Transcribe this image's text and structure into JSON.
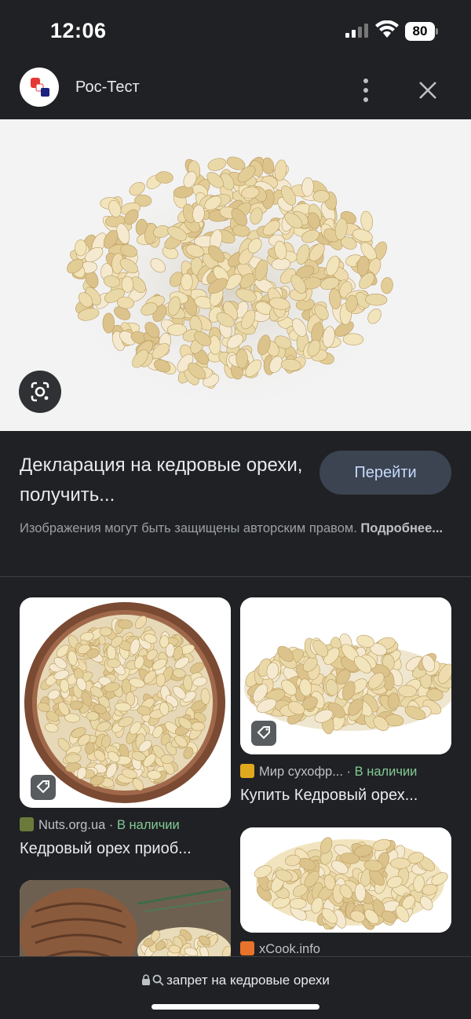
{
  "status_bar": {
    "time": "12:06",
    "battery": "80"
  },
  "header": {
    "site_title": "Рос-Тест"
  },
  "main": {
    "headline": "Декларация на кедровые орехи, получить...",
    "go_label": "Перейти",
    "copyright_text": "Изображения могут быть защищены авторским правом.",
    "copyright_link": "Подробнее..."
  },
  "results": [
    {
      "source": "Nuts.org.ua",
      "availability": "В наличии",
      "title": "Кедровый орех приоб..."
    },
    {
      "source": "Мир сухофр...",
      "availability": "В наличии",
      "title": "Купить Кедровый орех..."
    },
    {
      "source": "xCook.info"
    }
  ],
  "bottom": {
    "query": "запрет на кедровые орехи"
  },
  "colors": {
    "background": "#202124",
    "button_bg": "#3c4452",
    "availability_green": "#81c995",
    "muted_text": "#9aa0a6"
  },
  "icons": [
    "signal-icon",
    "wifi-icon",
    "more-vert-icon",
    "close-icon",
    "lens-icon",
    "tag-icon",
    "lock-icon",
    "search-icon"
  ]
}
